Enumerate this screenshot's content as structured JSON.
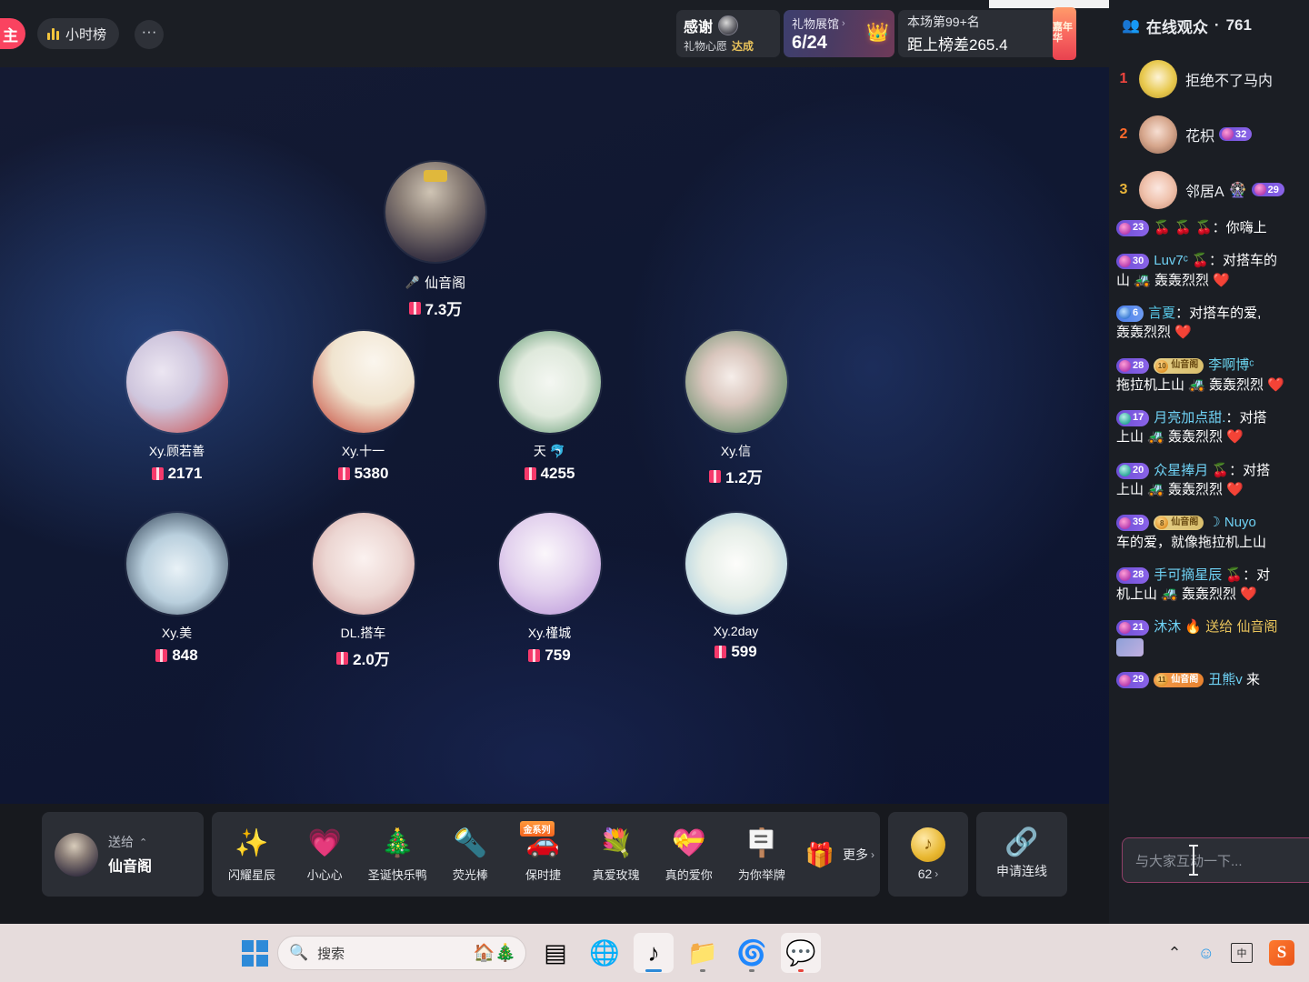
{
  "topbar": {
    "follow_label": "主",
    "hour_rank_label": "小时榜",
    "more_label": "···",
    "thanks": {
      "title": "感谢",
      "wish_label": "礼物心愿",
      "status": "达成"
    },
    "gift_hall": {
      "label": "礼物展馆",
      "chevron": "›",
      "count": "6/24",
      "crown_icon": "👑"
    },
    "rank": {
      "line1": "本场第99+名",
      "line2": "距上榜差265.4"
    },
    "carnival_label": "嘉年华"
  },
  "stage": {
    "host": {
      "name": "仙音阁",
      "mic_icon": "🎤",
      "gift_value": "7.3万"
    },
    "guests": [
      {
        "name": "Xy.顾若善",
        "gift_value": "2171",
        "art": "a1"
      },
      {
        "name": "Xy.十一",
        "gift_value": "5380",
        "art": "a2"
      },
      {
        "name": "天",
        "name_badge": "🐬",
        "gift_value": "4255",
        "art": "a3"
      },
      {
        "name": "Xy.信",
        "gift_value": "1.2万",
        "art": "a4"
      },
      {
        "name": "Xy.美",
        "gift_value": "848",
        "art": "a5"
      },
      {
        "name": "DL.搭车",
        "gift_value": "2.0万",
        "art": "a6"
      },
      {
        "name": "Xy.槿城",
        "gift_value": "759",
        "art": "a7"
      },
      {
        "name": "Xy.2day",
        "gift_value": "599",
        "art": "a8"
      }
    ]
  },
  "giftbar": {
    "send_to_label": "送给",
    "send_to_name": "仙音阁",
    "collapse_icon": "⌃",
    "gifts": [
      {
        "name": "闪耀星辰",
        "icon": "✨",
        "tag": ""
      },
      {
        "name": "小心心",
        "icon": "💗",
        "tag": ""
      },
      {
        "name": "圣诞快乐鸭",
        "icon": "🎄",
        "tag": ""
      },
      {
        "name": "荧光棒",
        "icon": "🔦",
        "tag": ""
      },
      {
        "name": "保时捷",
        "icon": "🚗",
        "tag": "金系列"
      },
      {
        "name": "真爱玫瑰",
        "icon": "💐",
        "tag": ""
      },
      {
        "name": "真的爱你",
        "icon": "💝",
        "tag": ""
      },
      {
        "name": "为你举牌",
        "icon": "🪧",
        "tag": ""
      }
    ],
    "more_label": "更多",
    "more_chevron": "›",
    "gift_box_icon": "🎁",
    "coin_value": "62",
    "coin_chevron": "›",
    "coin_icon": "♪",
    "link_label": "申请连线",
    "link_icon": "🔗"
  },
  "right_panel": {
    "viewers_title": "在线观众",
    "viewers_separator": "·",
    "viewers_count": "761",
    "people_icon": "👥",
    "viewers": [
      {
        "rank": "1",
        "name": "拒绝不了马内",
        "level": "",
        "art": "v1"
      },
      {
        "rank": "2",
        "name": "花枳",
        "level": "32",
        "art": "v2"
      },
      {
        "rank": "3",
        "name": "邻居A",
        "name_suffix": "🎡",
        "level": "29",
        "art": "v3"
      }
    ],
    "messages": [
      {
        "level": "23",
        "level_style": "purple",
        "user": "🍒 🍒 🍒",
        "colon": "：",
        "text": "你嗨上"
      },
      {
        "level": "30",
        "level_style": "purple",
        "user": "Luv7ᶜ 🍒",
        "colon": "：",
        "text": "对搭车的",
        "line2": "山 🚜 轰轰烈烈 ❤️"
      },
      {
        "level": "6",
        "level_style": "blue",
        "user": "言夏",
        "colon": "：",
        "text": "对搭车的爱,",
        "line2": "轰轰烈烈 ❤️"
      },
      {
        "level": "28",
        "level_style": "purple",
        "fan_badge": "10",
        "fan_name": "仙音阁",
        "fan_style": "gold",
        "user": "李啊博ᶜ",
        "colon": "",
        "text": "",
        "line2": "拖拉机上山 🚜 轰轰烈烈 ❤️"
      },
      {
        "level": "17",
        "level_style": "cyan",
        "user": "月亮加点甜.",
        "colon": "：",
        "text": "对搭",
        "line2": "上山 🚜 轰轰烈烈 ❤️"
      },
      {
        "level": "20",
        "level_style": "cyan",
        "user": "众星捧月 🍒",
        "colon": "：",
        "text": "对搭",
        "line2": "上山 🚜 轰轰烈烈 ❤️"
      },
      {
        "level": "39",
        "level_style": "purple",
        "fan_badge": "8",
        "fan_name": "仙音阁",
        "fan_style": "gold",
        "user": "☽ Nuyo",
        "colon": "",
        "text": "",
        "line2": "车的爱，就像拖拉机上山"
      },
      {
        "level": "28",
        "level_style": "purple",
        "user": "手可摘星辰 🍒",
        "colon": "：",
        "text": "对",
        "line2": "机上山 🚜 轰轰烈烈 ❤️"
      },
      {
        "level": "21",
        "level_style": "purple",
        "user": "沐沐 🔥",
        "colon": "",
        "text": "送给 仙音阁",
        "has_gift_chip": true
      },
      {
        "level": "29",
        "level_style": "purple",
        "fan_badge": "11",
        "fan_name": "仙音阁",
        "fan_style": "orange",
        "user": "丑熊v",
        "colon": "",
        "text": "来"
      }
    ],
    "input_placeholder": "与大家互动一下..."
  },
  "taskbar": {
    "search_placeholder": "搜索",
    "search_icon": "🔍",
    "search_emoji": "🏠🎄",
    "apps": [
      {
        "name": "task-view",
        "icon": "▤"
      },
      {
        "name": "edge-legacy",
        "icon": "🌐"
      },
      {
        "name": "tiktok",
        "icon": "♪"
      },
      {
        "name": "file-explorer",
        "icon": "📁"
      },
      {
        "name": "edge",
        "icon": "🌀"
      },
      {
        "name": "wechat",
        "icon": "💬"
      }
    ],
    "tray": {
      "chevron": "⌃",
      "app_icon": "☺",
      "ime_label": "中",
      "sogou_label": "S"
    }
  }
}
